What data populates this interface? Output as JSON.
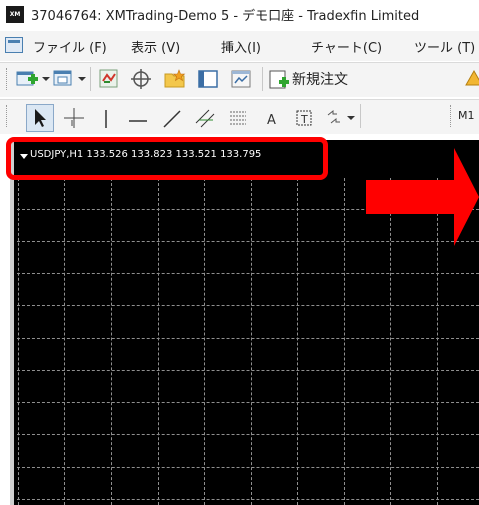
{
  "window": {
    "title": "37046764: XMTrading-Demo 5 - デモ口座 - Tradexfin Limited",
    "app_icon_text": "XM"
  },
  "menu": {
    "items": [
      "ファイル (F)",
      "表示 (V)",
      "挿入(I)",
      "チャート(C)",
      "ツール (T)"
    ]
  },
  "toolbar": {
    "new_order_label": "新規注文",
    "period_label": "M1"
  },
  "chart": {
    "symbol_info": "USDJPY,H1  133.526 133.823 133.521 133.795",
    "background": "#000000",
    "grid_color": "#8f8f8f"
  },
  "annotations": {
    "highlight_color": "#ff0000",
    "arrow_color": "#ff0000"
  }
}
